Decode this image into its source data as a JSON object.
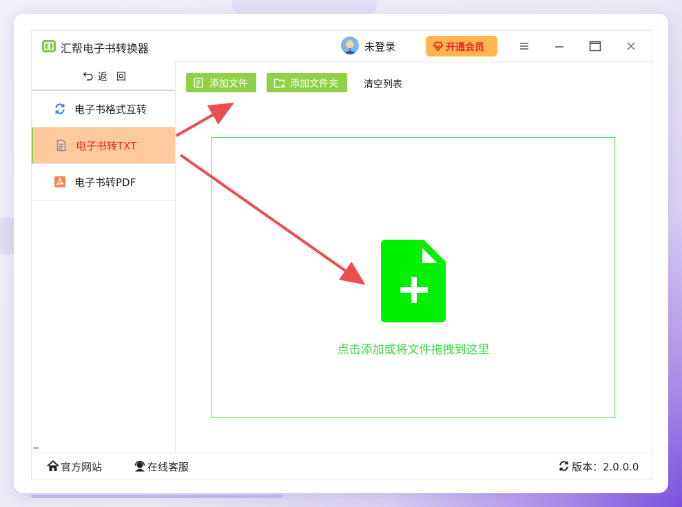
{
  "app": {
    "title": "汇帮电子书转换器"
  },
  "header": {
    "login_label": "未登录",
    "vip_label": "开通会员"
  },
  "sidebar": {
    "back_label": "返回",
    "items": [
      {
        "label": "电子书格式互转",
        "icon": "refresh-icon"
      },
      {
        "label": "电子书转TXT",
        "icon": "document-icon",
        "active": true
      },
      {
        "label": "电子书转PDF",
        "icon": "pdf-icon"
      }
    ]
  },
  "toolbar": {
    "add_file": "添加文件",
    "add_folder": "添加文件夹",
    "clear_list": "清空列表"
  },
  "dropzone": {
    "text": "点击添加或将文件拖拽到这里"
  },
  "footer": {
    "website": "官方网站",
    "support": "在线客服",
    "version": "版本：2.0.0.0"
  },
  "colors": {
    "accent_green": "#8fd046",
    "active_bg": "#ffca9b",
    "active_text": "#e5252a",
    "vip_bg": "#ffb74d",
    "drop_border": "#3fe43f",
    "arrow": "#ec4d4d"
  }
}
